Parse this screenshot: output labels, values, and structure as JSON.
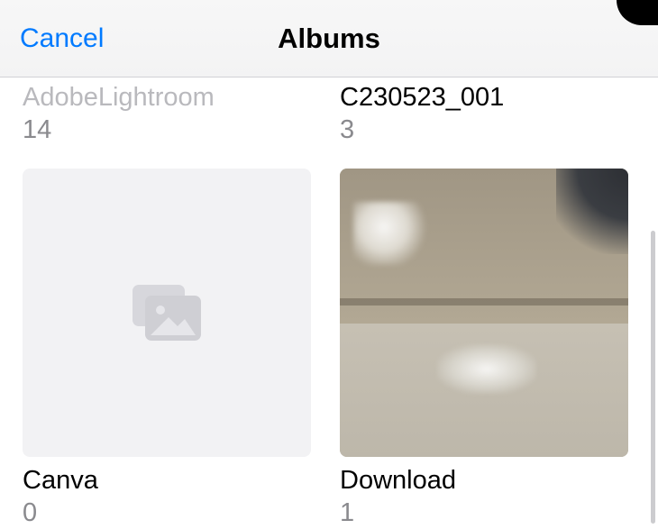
{
  "nav": {
    "cancel": "Cancel",
    "title": "Albums"
  },
  "partial_albums": [
    {
      "name": "AdobeLightroom",
      "count": "14",
      "faded": true
    },
    {
      "name": "C230523_001",
      "count": "3",
      "faded": false
    }
  ],
  "albums": [
    {
      "name": "Canva",
      "count": "0",
      "empty": true
    },
    {
      "name": "Download",
      "count": "1",
      "empty": false
    }
  ]
}
